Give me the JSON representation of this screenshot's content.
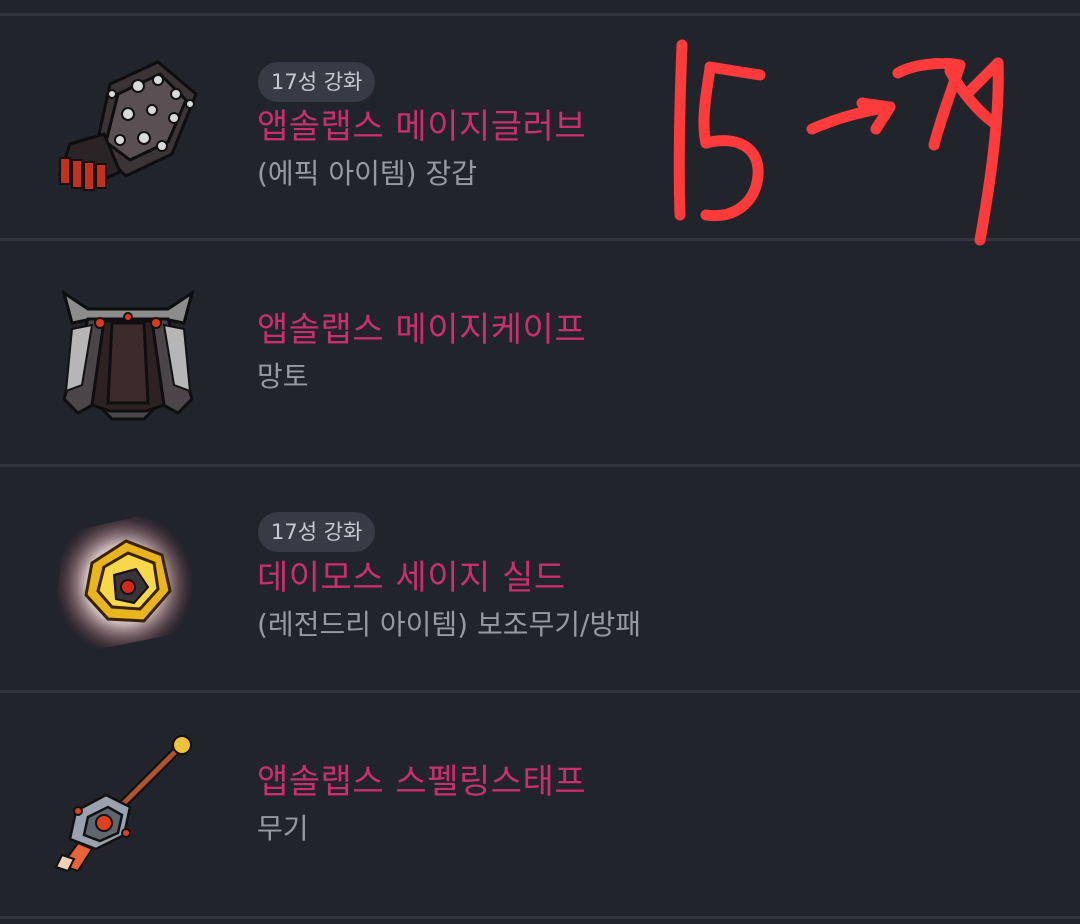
{
  "items": [
    {
      "icon": "gloves-icon",
      "star_label": "17성 강화",
      "name": "앱솔랩스 메이지글러브",
      "type": "(에픽 아이템) 장갑"
    },
    {
      "icon": "cape-icon",
      "star_label": "",
      "name": "앱솔랩스 메이지케이프",
      "type": "망토"
    },
    {
      "icon": "shield-icon",
      "star_label": "17성 강화",
      "name": "데이모스 세이지 실드",
      "type": "(레전드리 아이템) 보조무기/방패"
    },
    {
      "icon": "staff-icon",
      "star_label": "",
      "name": "앱솔랩스 스펠링스태프",
      "type": "무기"
    }
  ],
  "annotation": {
    "text": "15→17",
    "color": "#ff3a3a"
  },
  "colors": {
    "background": "#22242b",
    "divider": "#31343c",
    "item_name": "#c8306a",
    "item_type": "#989aa2",
    "badge_bg": "#383b45"
  }
}
